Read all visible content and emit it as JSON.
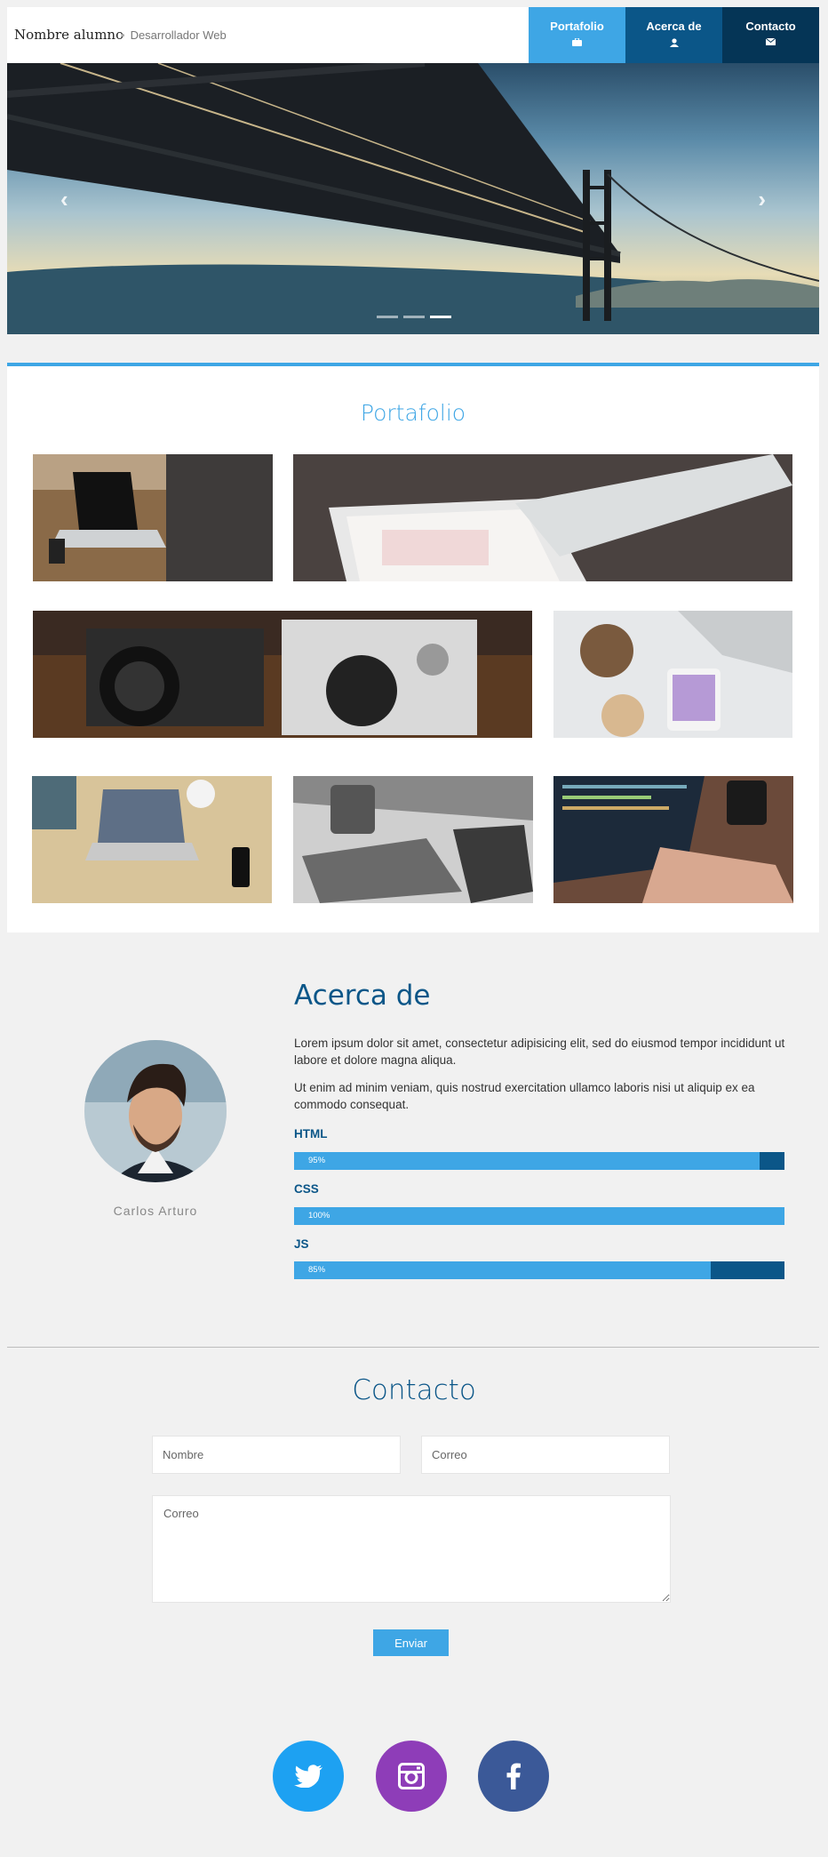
{
  "header": {
    "brand": "Nombre alumno",
    "role": "Desarrollador Web",
    "nav": [
      {
        "label": "Portafolio",
        "icon": "briefcase-icon"
      },
      {
        "label": "Acerca de",
        "icon": "user-icon"
      },
      {
        "label": "Contacto",
        "icon": "envelope-icon"
      }
    ]
  },
  "hero": {
    "prev": "‹",
    "next": "›",
    "slides": 3,
    "active_slide": 2
  },
  "portfolio": {
    "title": "Portafolio"
  },
  "about": {
    "title": "Acerca de",
    "name": "Carlos Arturo",
    "paragraphs": [
      "Lorem ipsum dolor sit amet, consectetur adipisicing elit, sed do eiusmod tempor incididunt ut labore et dolore magna aliqua.",
      "Ut enim ad minim veniam, quis nostrud exercitation ullamco laboris nisi ut aliquip ex ea commodo consequat."
    ],
    "skills": [
      {
        "name": "HTML",
        "percent": 95,
        "label": "95%"
      },
      {
        "name": "CSS",
        "percent": 100,
        "label": "100%"
      },
      {
        "name": "JS",
        "percent": 85,
        "label": "85%"
      }
    ]
  },
  "contact": {
    "title": "Contacto",
    "name_placeholder": "Nombre",
    "email_placeholder": "Correo",
    "message_placeholder": "Correo",
    "submit_label": "Enviar"
  },
  "colors": {
    "accent": "#3ea6e5",
    "dark_blue": "#0b5688",
    "navy": "#053556",
    "twitter": "#1da1f2",
    "instagram": "#8e3db8",
    "facebook": "#3b5998"
  },
  "social": [
    {
      "name": "twitter",
      "icon": "twitter-icon"
    },
    {
      "name": "instagram",
      "icon": "instagram-icon"
    },
    {
      "name": "facebook",
      "icon": "facebook-icon"
    }
  ]
}
